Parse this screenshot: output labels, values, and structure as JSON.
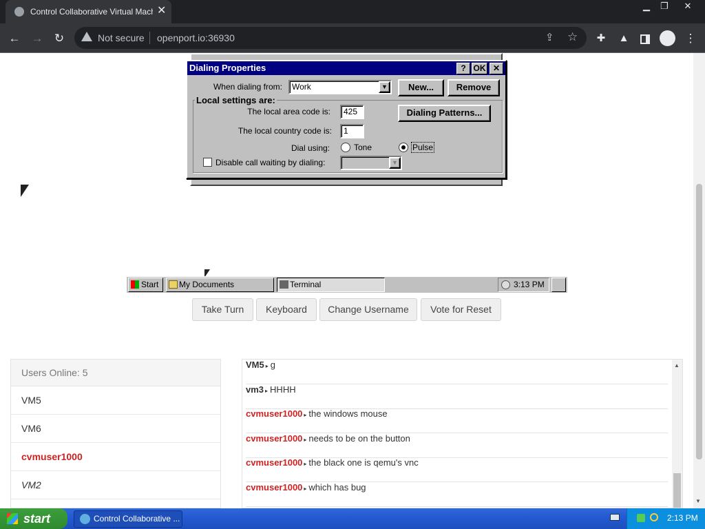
{
  "browser": {
    "tab_title": "Control Collaborative Virtual Machine",
    "tab_close": "✕",
    "security_label": "Not secure",
    "url": "openport.io:36930"
  },
  "dialog": {
    "title": "Dialing Properties",
    "help": "?",
    "ok": "OK",
    "close": "✕",
    "dialing_from_label": "When dialing from:",
    "dialing_from_value": "Work",
    "new_button": "New...",
    "remove_button": "Remove",
    "group_label": "Local settings are:",
    "area_code_label": "The local area code is:",
    "area_code_value": "425",
    "country_code_label": "The local country code is:",
    "country_code_value": "1",
    "dialing_patterns_button": "Dialing Patterns...",
    "dial_using_label": "Dial using:",
    "tone_label": "Tone",
    "pulse_label": "Pulse",
    "selected_dial_mode": "pulse",
    "disable_call_waiting_label": "Disable call waiting by dialing:",
    "disable_call_waiting_checked": false
  },
  "vm_taskbar": {
    "start": "Start",
    "items": [
      "My Documents",
      "Terminal"
    ],
    "clock": "3:13 PM"
  },
  "controls": [
    "Take Turn",
    "Keyboard",
    "Change Username",
    "Vote for Reset"
  ],
  "users_panel": {
    "header": "Users Online: 5",
    "users": [
      {
        "name": "VM5",
        "style": "normal"
      },
      {
        "name": "VM6",
        "style": "normal"
      },
      {
        "name": "cvmuser1000",
        "style": "highlight"
      },
      {
        "name": "VM2",
        "style": "italic"
      }
    ]
  },
  "chat": {
    "messages": [
      {
        "user": "VM5",
        "text": "g",
        "user_color": "#222222"
      },
      {
        "user": "vm3",
        "text": "HHHH",
        "user_color": "#222222"
      },
      {
        "user": "cvmuser1000",
        "text": "the windows mouse",
        "user_color": "#cc2222"
      },
      {
        "user": "cvmuser1000",
        "text": "needs to be on the button",
        "user_color": "#cc2222"
      },
      {
        "user": "cvmuser1000",
        "text": "the black one is qemu's vnc",
        "user_color": "#cc2222"
      },
      {
        "user": "cvmuser1000",
        "text": "which has bug",
        "user_color": "#cc2222"
      }
    ]
  },
  "os_taskbar": {
    "start": "start",
    "task": "Control Collaborative ...",
    "clock": "2:13 PM"
  },
  "colors": {
    "accent_red": "#cc2222",
    "xp_blue": "#245ad3",
    "win98_title": "#000080"
  }
}
